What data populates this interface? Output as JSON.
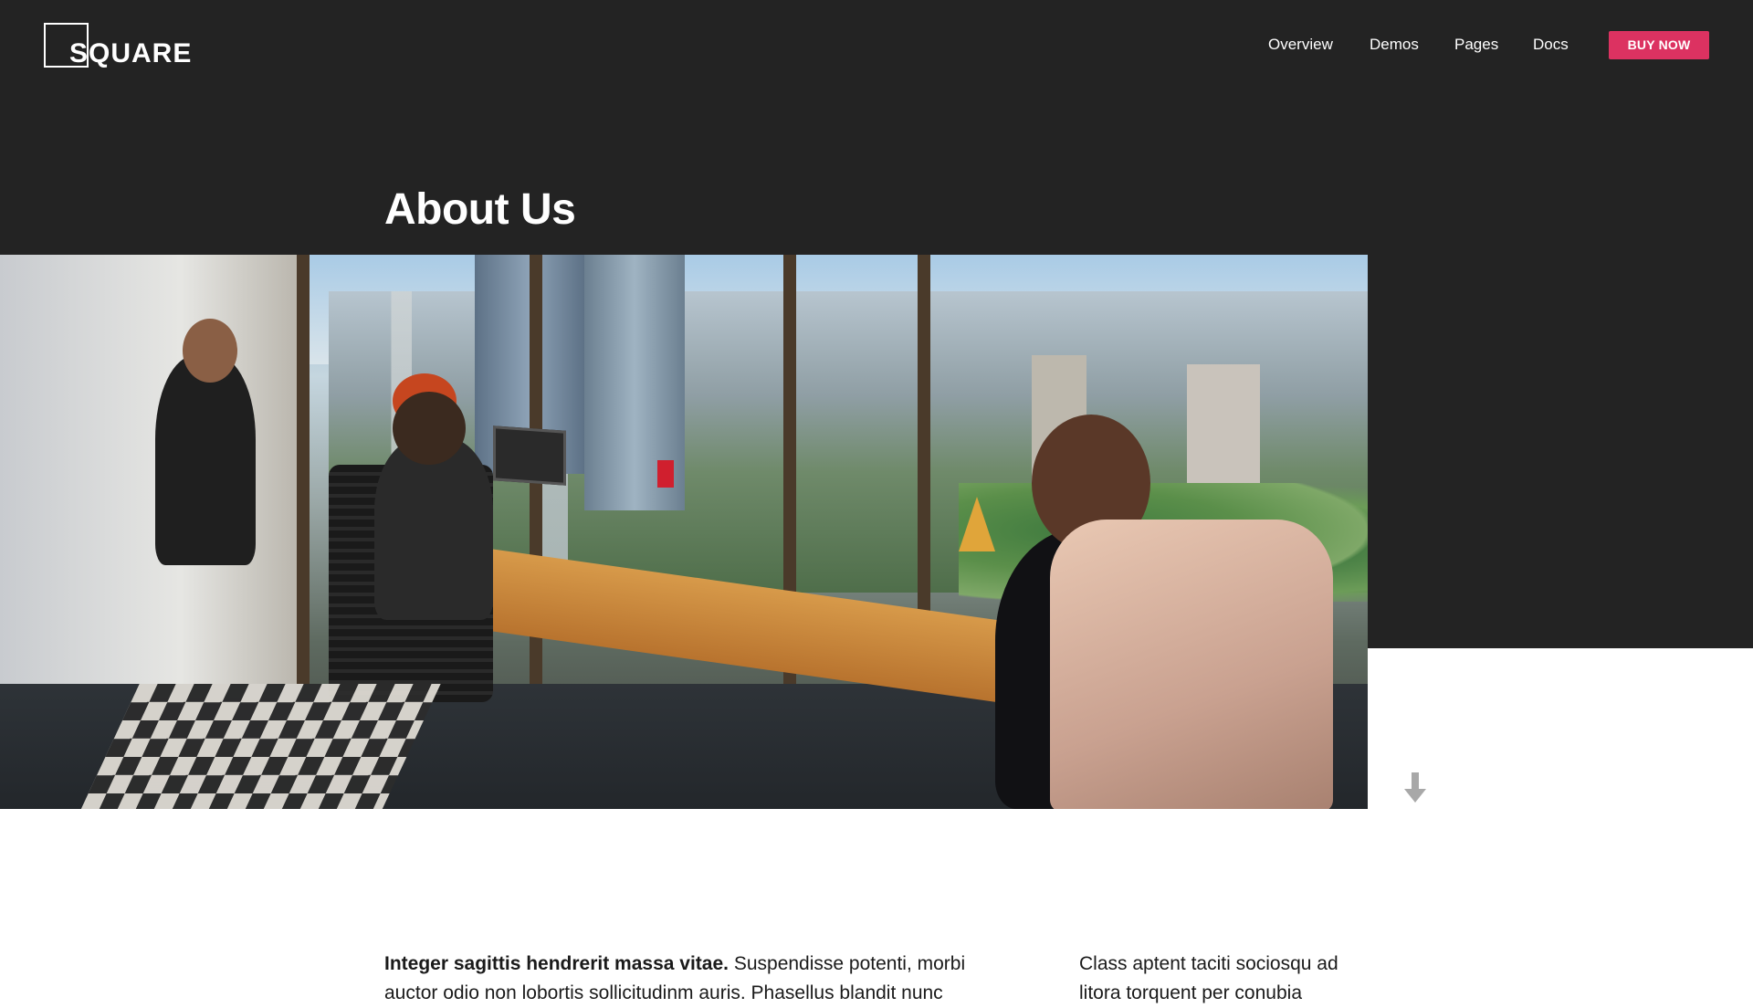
{
  "brand": {
    "logo_text": "SQUARE"
  },
  "nav": {
    "items": [
      {
        "label": "Overview"
      },
      {
        "label": "Demos"
      },
      {
        "label": "Pages"
      },
      {
        "label": "Docs"
      }
    ],
    "cta_label": "BUY NOW"
  },
  "colors": {
    "background_dark": "#232323",
    "accent": "#dc3261",
    "text_light": "#ffffff",
    "text_dark": "#1a1a1a"
  },
  "hero": {
    "title": "About Us",
    "image": "office-coworking-photo"
  },
  "icons": {
    "scroll": "arrow-down-icon"
  },
  "body": {
    "left_lead": "Integer sagittis hendrerit massa vitae.",
    "left_text": "Suspendisse potenti, morbi auctor odio non lobortis sollicitudinm auris. Phasellus blandit nunc",
    "right_text": "Class aptent taciti sociosqu ad litora torquent per conubia"
  }
}
